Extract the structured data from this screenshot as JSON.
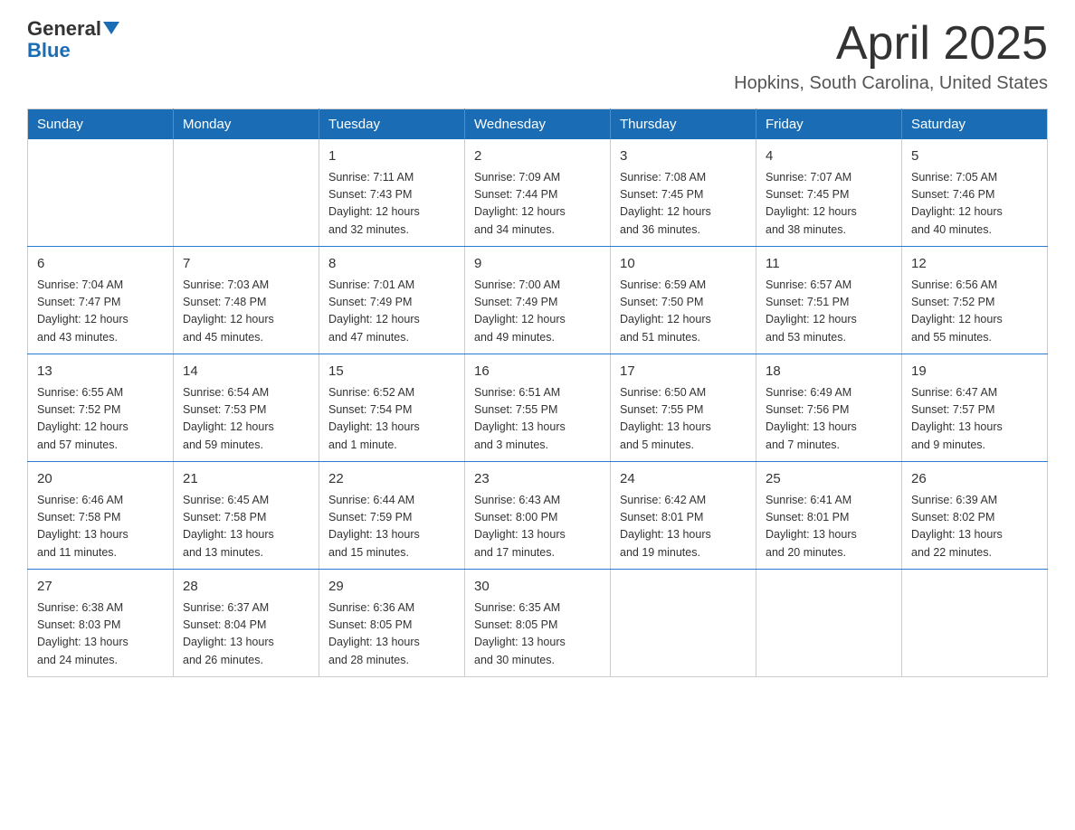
{
  "header": {
    "logo_general": "General",
    "logo_blue": "Blue",
    "month_title": "April 2025",
    "location": "Hopkins, South Carolina, United States"
  },
  "days_of_week": [
    "Sunday",
    "Monday",
    "Tuesday",
    "Wednesday",
    "Thursday",
    "Friday",
    "Saturday"
  ],
  "weeks": [
    [
      {
        "day": "",
        "info": ""
      },
      {
        "day": "",
        "info": ""
      },
      {
        "day": "1",
        "info": "Sunrise: 7:11 AM\nSunset: 7:43 PM\nDaylight: 12 hours\nand 32 minutes."
      },
      {
        "day": "2",
        "info": "Sunrise: 7:09 AM\nSunset: 7:44 PM\nDaylight: 12 hours\nand 34 minutes."
      },
      {
        "day": "3",
        "info": "Sunrise: 7:08 AM\nSunset: 7:45 PM\nDaylight: 12 hours\nand 36 minutes."
      },
      {
        "day": "4",
        "info": "Sunrise: 7:07 AM\nSunset: 7:45 PM\nDaylight: 12 hours\nand 38 minutes."
      },
      {
        "day": "5",
        "info": "Sunrise: 7:05 AM\nSunset: 7:46 PM\nDaylight: 12 hours\nand 40 minutes."
      }
    ],
    [
      {
        "day": "6",
        "info": "Sunrise: 7:04 AM\nSunset: 7:47 PM\nDaylight: 12 hours\nand 43 minutes."
      },
      {
        "day": "7",
        "info": "Sunrise: 7:03 AM\nSunset: 7:48 PM\nDaylight: 12 hours\nand 45 minutes."
      },
      {
        "day": "8",
        "info": "Sunrise: 7:01 AM\nSunset: 7:49 PM\nDaylight: 12 hours\nand 47 minutes."
      },
      {
        "day": "9",
        "info": "Sunrise: 7:00 AM\nSunset: 7:49 PM\nDaylight: 12 hours\nand 49 minutes."
      },
      {
        "day": "10",
        "info": "Sunrise: 6:59 AM\nSunset: 7:50 PM\nDaylight: 12 hours\nand 51 minutes."
      },
      {
        "day": "11",
        "info": "Sunrise: 6:57 AM\nSunset: 7:51 PM\nDaylight: 12 hours\nand 53 minutes."
      },
      {
        "day": "12",
        "info": "Sunrise: 6:56 AM\nSunset: 7:52 PM\nDaylight: 12 hours\nand 55 minutes."
      }
    ],
    [
      {
        "day": "13",
        "info": "Sunrise: 6:55 AM\nSunset: 7:52 PM\nDaylight: 12 hours\nand 57 minutes."
      },
      {
        "day": "14",
        "info": "Sunrise: 6:54 AM\nSunset: 7:53 PM\nDaylight: 12 hours\nand 59 minutes."
      },
      {
        "day": "15",
        "info": "Sunrise: 6:52 AM\nSunset: 7:54 PM\nDaylight: 13 hours\nand 1 minute."
      },
      {
        "day": "16",
        "info": "Sunrise: 6:51 AM\nSunset: 7:55 PM\nDaylight: 13 hours\nand 3 minutes."
      },
      {
        "day": "17",
        "info": "Sunrise: 6:50 AM\nSunset: 7:55 PM\nDaylight: 13 hours\nand 5 minutes."
      },
      {
        "day": "18",
        "info": "Sunrise: 6:49 AM\nSunset: 7:56 PM\nDaylight: 13 hours\nand 7 minutes."
      },
      {
        "day": "19",
        "info": "Sunrise: 6:47 AM\nSunset: 7:57 PM\nDaylight: 13 hours\nand 9 minutes."
      }
    ],
    [
      {
        "day": "20",
        "info": "Sunrise: 6:46 AM\nSunset: 7:58 PM\nDaylight: 13 hours\nand 11 minutes."
      },
      {
        "day": "21",
        "info": "Sunrise: 6:45 AM\nSunset: 7:58 PM\nDaylight: 13 hours\nand 13 minutes."
      },
      {
        "day": "22",
        "info": "Sunrise: 6:44 AM\nSunset: 7:59 PM\nDaylight: 13 hours\nand 15 minutes."
      },
      {
        "day": "23",
        "info": "Sunrise: 6:43 AM\nSunset: 8:00 PM\nDaylight: 13 hours\nand 17 minutes."
      },
      {
        "day": "24",
        "info": "Sunrise: 6:42 AM\nSunset: 8:01 PM\nDaylight: 13 hours\nand 19 minutes."
      },
      {
        "day": "25",
        "info": "Sunrise: 6:41 AM\nSunset: 8:01 PM\nDaylight: 13 hours\nand 20 minutes."
      },
      {
        "day": "26",
        "info": "Sunrise: 6:39 AM\nSunset: 8:02 PM\nDaylight: 13 hours\nand 22 minutes."
      }
    ],
    [
      {
        "day": "27",
        "info": "Sunrise: 6:38 AM\nSunset: 8:03 PM\nDaylight: 13 hours\nand 24 minutes."
      },
      {
        "day": "28",
        "info": "Sunrise: 6:37 AM\nSunset: 8:04 PM\nDaylight: 13 hours\nand 26 minutes."
      },
      {
        "day": "29",
        "info": "Sunrise: 6:36 AM\nSunset: 8:05 PM\nDaylight: 13 hours\nand 28 minutes."
      },
      {
        "day": "30",
        "info": "Sunrise: 6:35 AM\nSunset: 8:05 PM\nDaylight: 13 hours\nand 30 minutes."
      },
      {
        "day": "",
        "info": ""
      },
      {
        "day": "",
        "info": ""
      },
      {
        "day": "",
        "info": ""
      }
    ]
  ]
}
